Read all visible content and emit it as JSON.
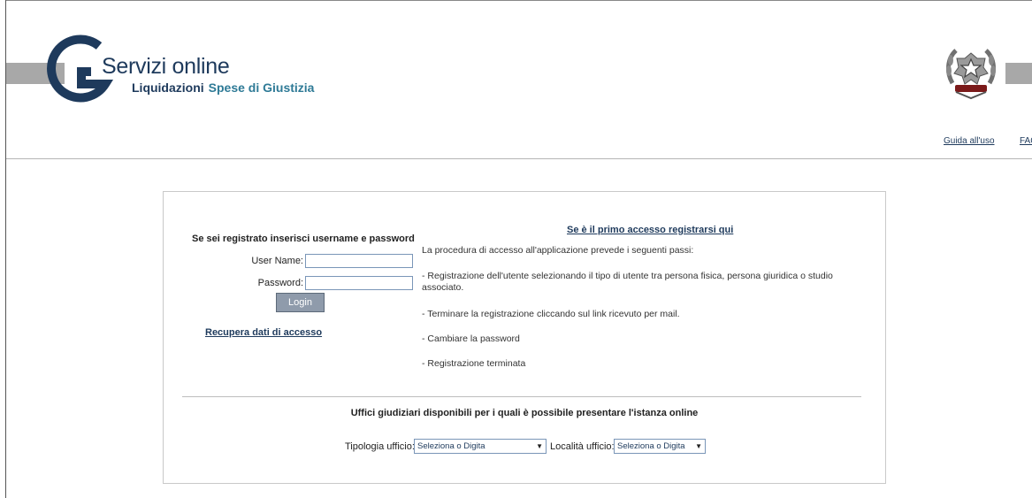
{
  "header": {
    "logo_title": "Servizi online",
    "logo_sub_a": "Liquidazioni",
    "logo_sub_b": "Spese di Giustizia",
    "links": [
      "Guida all'uso",
      "FAQ"
    ]
  },
  "login": {
    "heading": "Se sei registrato inserisci username e password",
    "username_label": "User Name:",
    "username_value": "",
    "password_label": "Password:",
    "password_value": "",
    "button_label": "Login",
    "recover_link": "Recupera dati di accesso"
  },
  "registration": {
    "link": "Se è il primo accesso registrarsi qui",
    "intro": "La procedura di accesso all'applicazione prevede i seguenti passi:",
    "step1": "- Registrazione dell'utente selezionando il tipo di utente tra persona fisica, persona giuridica o studio associato.",
    "step2": "- Terminare la registrazione cliccando sul link ricevuto per mail.",
    "step3": "- Cambiare la password",
    "step4": "- Registrazione terminata"
  },
  "offices": {
    "heading": "Uffici giudiziari disponibili per i quali è possibile presentare l'istanza online",
    "type_label": "Tipologia ufficio:",
    "type_value": "Seleziona o Digita",
    "place_label": "Località ufficio:",
    "place_value": "Seleziona o Digita",
    "arrow": "▼"
  },
  "colors": {
    "brand": "#1e3a5c",
    "accent": "#2e7a96",
    "bar": "#a8a8a8"
  }
}
